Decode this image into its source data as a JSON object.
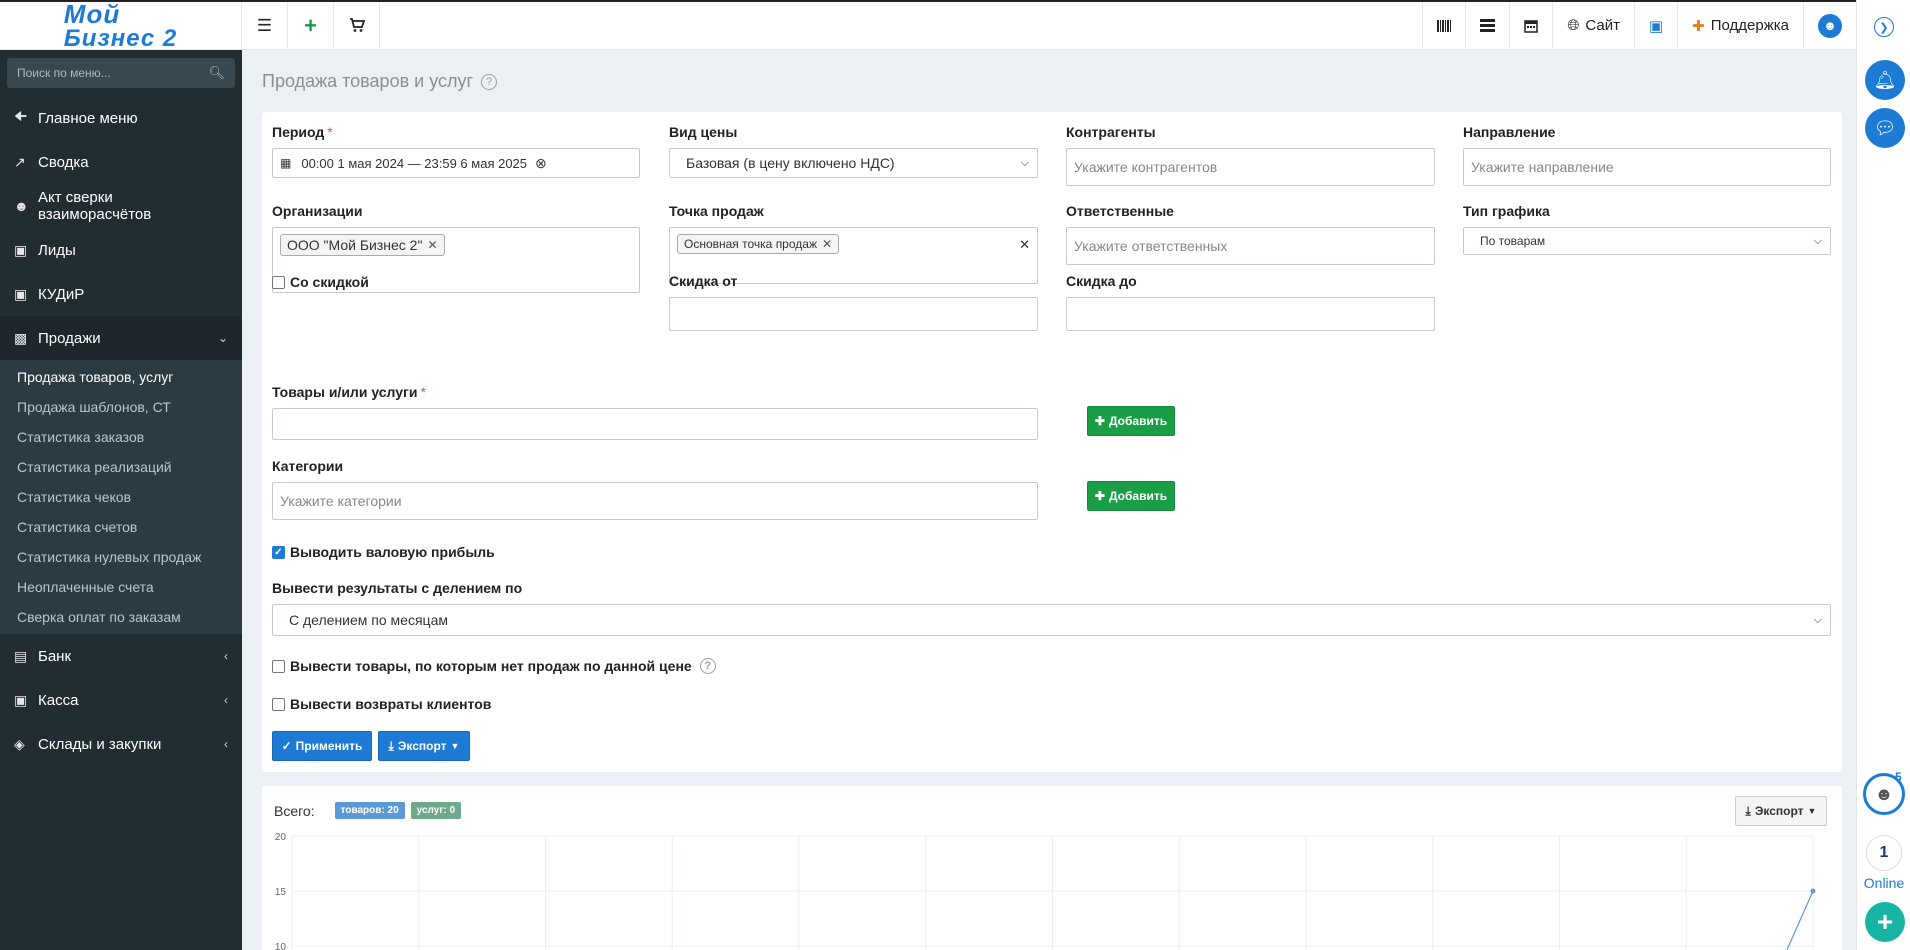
{
  "app": {
    "logo_line1": "Мой",
    "logo_line2": "Бизнес 2",
    "site_label": "Сайт",
    "support_label": "Поддержка"
  },
  "icons": {
    "menu": "menu-icon",
    "add": "plus-icon",
    "cart": "cart-icon",
    "barcode": "barcode-icon",
    "list": "list-icon",
    "calendar": "calendar-icon",
    "globe": "globe-icon",
    "support": "medkit-icon",
    "user": "user-icon"
  },
  "sidebar": {
    "search_placeholder": "Поиск по меню...",
    "items": [
      {
        "label": "Главное меню",
        "icon": "arrow-left-icon"
      },
      {
        "label": "Сводка",
        "icon": "line-chart-icon"
      },
      {
        "label": "Акт сверки взаиморасчётов",
        "icon": "users-icon"
      },
      {
        "label": "Лиды",
        "icon": "contact-card-icon"
      },
      {
        "label": "КУДиР",
        "icon": "contact-card-icon"
      },
      {
        "label": "Продажи",
        "icon": "bar-chart-icon"
      }
    ],
    "sub_items": [
      {
        "label": "Продажа товаров, услуг",
        "active": true
      },
      {
        "label": "Продажа шаблонов, СТ",
        "active": false
      },
      {
        "label": "Статистика заказов",
        "active": false
      },
      {
        "label": "Статистика реализаций",
        "active": false
      },
      {
        "label": "Статистика чеков",
        "active": false
      },
      {
        "label": "Статистика счетов",
        "active": false
      },
      {
        "label": "Статистика нулевых продаж",
        "active": false
      },
      {
        "label": "Неоплаченные счета",
        "active": false
      },
      {
        "label": "Сверка оплат по заказам",
        "active": false
      }
    ],
    "items_after": [
      {
        "label": "Банк",
        "icon": "credit-card-icon"
      },
      {
        "label": "Касса",
        "icon": "money-icon"
      },
      {
        "label": "Склады и закупки",
        "icon": "cube-icon"
      }
    ]
  },
  "page": {
    "title": "Продажа товаров и услуг"
  },
  "filters": {
    "period": {
      "label": "Период",
      "value": "00:00 1 мая 2024 — 23:59 6 мая 2025"
    },
    "price_type": {
      "label": "Вид цены",
      "value": "Базовая (в цену включено НДС)"
    },
    "counterparties": {
      "label": "Контрагенты",
      "placeholder": "Укажите контрагентов"
    },
    "direction": {
      "label": "Направление",
      "placeholder": "Укажите направление"
    },
    "organizations": {
      "label": "Организации",
      "tag": "ООО \"Мой Бизнес 2\""
    },
    "sale_point": {
      "label": "Точка продаж",
      "tag": "Основная точка продаж"
    },
    "responsible": {
      "label": "Ответственные",
      "placeholder": "Укажите ответственных"
    },
    "chart_type": {
      "label": "Тип графика",
      "value": "По товарам"
    },
    "with_discount": {
      "label": "Со скидкой",
      "checked": false
    },
    "discount_from": {
      "label": "Скидка от",
      "value": ""
    },
    "discount_to": {
      "label": "Скидка до",
      "value": ""
    },
    "goods": {
      "label": "Товары и/или услуги",
      "value": ""
    },
    "add_label": "Добавить",
    "categories": {
      "label": "Категории",
      "placeholder": "Укажите категории"
    },
    "gross_profit": {
      "label": "Выводить валовую прибыль",
      "checked": true
    },
    "split_by": {
      "label": "Вывести результаты с делением по",
      "value": "С делением по месяцам"
    },
    "no_sales_goods": {
      "label": "Вывести товары, по которым нет продаж по данной цене",
      "checked": false
    },
    "returns": {
      "label": "Вывести возвраты клиентов",
      "checked": false
    },
    "apply_label": "Применить",
    "export_label": "Экспорт"
  },
  "results": {
    "total_label": "Всего:",
    "goods_pill": "товаров: 20",
    "services_pill": "услуг: 0",
    "export_label": "Экспорт"
  },
  "right_panel": {
    "bot_badge": "5",
    "online_count": "1",
    "online_label": "Online"
  },
  "chart_data": {
    "type": "line",
    "y_ticks": [
      20,
      15,
      10
    ],
    "ylim": [
      0,
      20
    ],
    "x_count": 13,
    "values": [
      null,
      null,
      null,
      null,
      null,
      null,
      null,
      null,
      null,
      null,
      null,
      null,
      15
    ],
    "grid": true,
    "color": "#5b9bd5"
  }
}
